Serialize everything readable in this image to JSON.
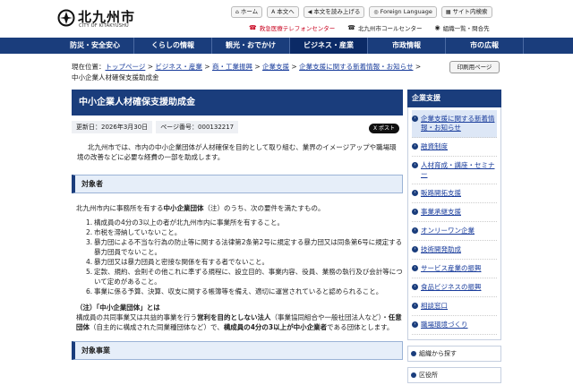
{
  "header": {
    "logo_title": "北九州市",
    "logo_sub": "CITY OF KITAKYUSHU",
    "util": [
      {
        "icon": "home-icon",
        "glyph": "⌂",
        "label": "ホーム"
      },
      {
        "icon": "text-size-icon",
        "glyph": "A",
        "label": "本文へ"
      },
      {
        "icon": "speaker-icon",
        "glyph": "◀",
        "label": "本文を読み上げる"
      },
      {
        "icon": "globe-icon",
        "glyph": "◎",
        "label": "Foreign Language"
      },
      {
        "icon": "sitemap-icon",
        "glyph": "▦",
        "label": "サイト内検索"
      }
    ],
    "tel": [
      {
        "icon": "phone-icon",
        "label": "救急医療テレフォンセンター"
      },
      {
        "icon": "phone-icon",
        "label": "北九州市コールセンター"
      },
      {
        "icon": "org-icon",
        "label": "組織一覧・問合先"
      }
    ]
  },
  "gnav": [
    "防災・安全安心",
    "くらしの情報",
    "観光・おでかけ",
    "ビジネス・産業",
    "市政情報",
    "市の広報"
  ],
  "breadcrumb": {
    "prefix": "現在位置：",
    "links": [
      "トップページ",
      "ビジネス・産業",
      "商・工業振興",
      "企業支援",
      "企業支援に関する新着情報・お知らせ"
    ],
    "current": "中小企業人材確保支援助成金"
  },
  "print_label": "印刷用ページ",
  "main": {
    "title": "中小企業人材確保支援助成金",
    "updated": "更新日：2026年3月30日",
    "page_no": "ページ番号：000132217",
    "xpost": "X ポスト",
    "intro": "北九州市では、市内の中小企業団体が人材確保を目的として取り組む、業界のイメージアップや職場環境の改善などに必要な経費の一部を助成します。",
    "section1_title": "対象者",
    "section1_text_a": "北九州市内に事務所を有する",
    "section1_text_b": "中小企業団体",
    "section1_text_c": "（注）のうち、次の要件を満たすもの。",
    "requirements": [
      "構成員の4分の3以上の者が北九州市内に事業所を有すること。",
      "市税を滞納していないこと。",
      "暴力団による不当な行為の防止等に関する法律第2条第2号に規定する暴力団又は同条第6号に規定する暴力団員でないこと。",
      "暴力団又は暴力団員と密接な関係を有する者でないこと。",
      "定款、規約、会則その他これに準ずる規程に、設立目的、事業内容、役員、業務の執行及び会計等について定めがあること。",
      "事業に係る予算、決算、収支に関する帳簿等を備え、適切に運営されていると認められること。"
    ],
    "note_head": "（注）「中小企業団体」とは",
    "note_a": "構成員の共同事業又は共益的事業を行う",
    "note_b": "営利を目的としない法人",
    "note_c": "（事業協同組合や一般社団法人など）・",
    "note_d": "任意団体",
    "note_e": "（自主的に構成された同業種団体など）で、",
    "note_f": "構成員の4分の3以上が中小企業者",
    "note_g": "である団体とします。",
    "section2_title": "対象事業"
  },
  "sidebar": {
    "title": "企業支援",
    "items": [
      "企業支援に関する新着情報・お知らせ",
      "融資制度",
      "人材育成・講座・セミナー",
      "販路開拓支援",
      "事業承継支援",
      "オンリーワン企業",
      "技術開発助成",
      "サービス産業の振興",
      "食品ビジネスの振興",
      "相談窓口",
      "職場環境づくり"
    ],
    "box1": "組織から探す",
    "box2": "区役所"
  }
}
